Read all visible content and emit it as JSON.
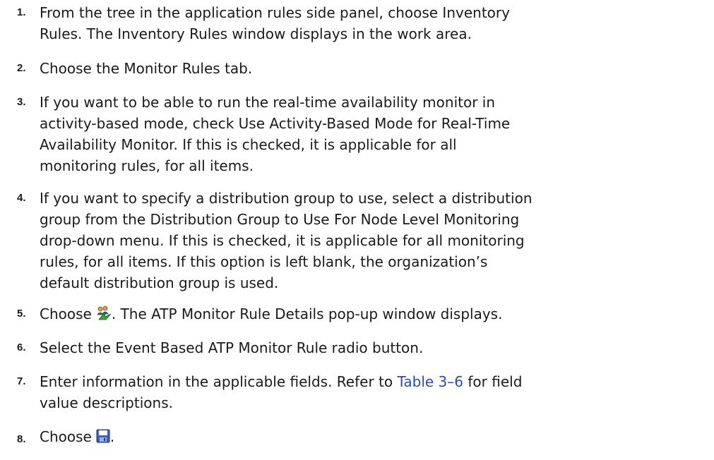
{
  "steps": [
    {
      "num": "1.",
      "lines": [
        "From the tree in the application rules side panel, choose Inventory",
        "Rules. The Inventory Rules window displays in the work area."
      ]
    },
    {
      "num": "2.",
      "lines": [
        "Choose the Monitor Rules tab."
      ]
    },
    {
      "num": "3.",
      "lines": [
        "If you want to be able to run the real-time availability monitor in",
        "activity-based mode, check Use Activity-Based Mode for Real-Time",
        "Availability Monitor. If this is checked, it is applicable for all",
        "monitoring rules, for all items."
      ]
    },
    {
      "num": "4.",
      "lines": [
        "If you want to specify a distribution group to use, select a distribution",
        "group from the Distribution Group to Use For Node Level Monitoring",
        "drop-down menu. If this is checked, it is applicable for all monitoring",
        "rules, for all items. If this option is left blank, the organization’s",
        "default distribution group is used."
      ]
    },
    {
      "num": "5.",
      "before_icon": "Choose",
      "icon": "add-rule-icon",
      "after_icon": ". The ATP Monitor Rule Details pop-up window displays."
    },
    {
      "num": "6.",
      "lines": [
        "Select the Event Based ATP Monitor Rule radio button."
      ]
    },
    {
      "num": "7.",
      "line1_pre": "Enter information in the applicable fields. Refer to ",
      "link": "Table 3–6",
      "line1_post": " for field",
      "line2": "value descriptions."
    },
    {
      "num": "8.",
      "before_icon": "Choose",
      "icon": "save-icon",
      "after_icon": "."
    }
  ],
  "colors": {
    "text": "#1a1a1a",
    "link": "#2a49c8"
  }
}
